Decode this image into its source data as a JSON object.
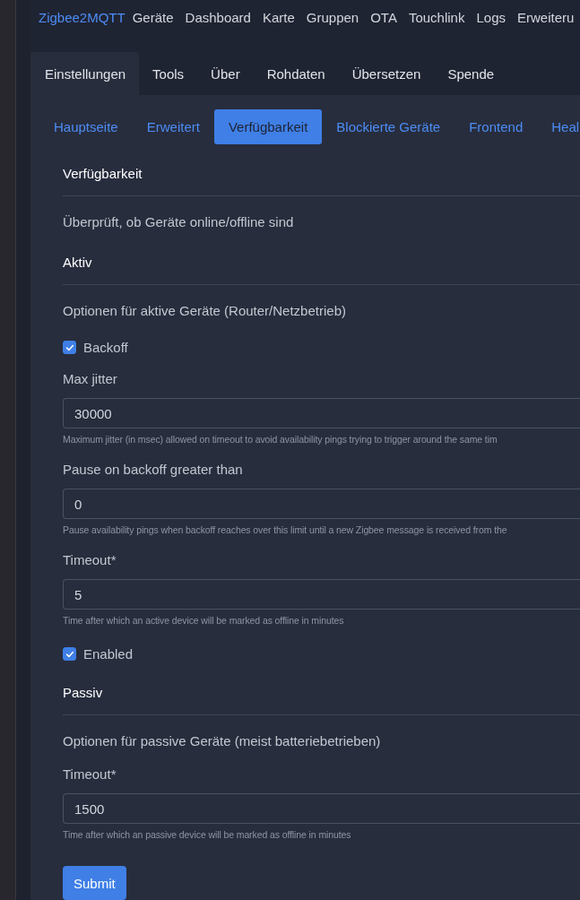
{
  "navbar": {
    "brand": "Zigbee2MQTT",
    "links": [
      "Geräte",
      "Dashboard",
      "Karte",
      "Gruppen",
      "OTA",
      "Touchlink",
      "Logs",
      "Erweiteru"
    ]
  },
  "tabs": [
    {
      "label": "Einstellungen",
      "selected": true
    },
    {
      "label": "Tools",
      "selected": false
    },
    {
      "label": "Über",
      "selected": false
    },
    {
      "label": "Rohdaten",
      "selected": false
    },
    {
      "label": "Übersetzen",
      "selected": false
    },
    {
      "label": "Spende",
      "selected": false
    }
  ],
  "subtabs": [
    {
      "label": "Hauptseite",
      "selected": false
    },
    {
      "label": "Erweitert",
      "selected": false
    },
    {
      "label": "Verfügbarkeit",
      "selected": true
    },
    {
      "label": "Blockierte Geräte",
      "selected": false
    },
    {
      "label": "Frontend",
      "selected": false
    },
    {
      "label": "Heal",
      "selected": false
    }
  ],
  "form": [
    {
      "kind": "heading",
      "text": "Verfügbarkeit"
    },
    {
      "kind": "description",
      "text": "Überprüft, ob Geräte online/offline sind"
    },
    {
      "kind": "heading",
      "text": "Aktiv"
    },
    {
      "kind": "description",
      "text": "Optionen für aktive Geräte (Router/Netzbetrieb)"
    },
    {
      "kind": "checkbox",
      "label": "Backoff",
      "checked": true
    },
    {
      "kind": "field",
      "label": "Max jitter",
      "value": "30000",
      "hint": "Maximum jitter (in msec) allowed on timeout to avoid availability pings trying to trigger around the same tim"
    },
    {
      "kind": "field",
      "label": "Pause on backoff greater than",
      "value": "0",
      "hint": "Pause availability pings when backoff reaches over this limit until a new Zigbee message is received from the"
    },
    {
      "kind": "field",
      "label": "Timeout*",
      "value": "5",
      "hint": "Time after which an active device will be marked as offline in minutes"
    },
    {
      "kind": "checkbox",
      "label": "Enabled",
      "checked": true
    },
    {
      "kind": "heading",
      "text": "Passiv"
    },
    {
      "kind": "description",
      "text": "Optionen für passive Geräte (meist batteriebetrieben)"
    },
    {
      "kind": "field",
      "label": "Timeout*",
      "value": "1500",
      "hint": "Time after which an passive device will be marked as offline in minutes"
    },
    {
      "kind": "button",
      "label": "Submit"
    }
  ]
}
